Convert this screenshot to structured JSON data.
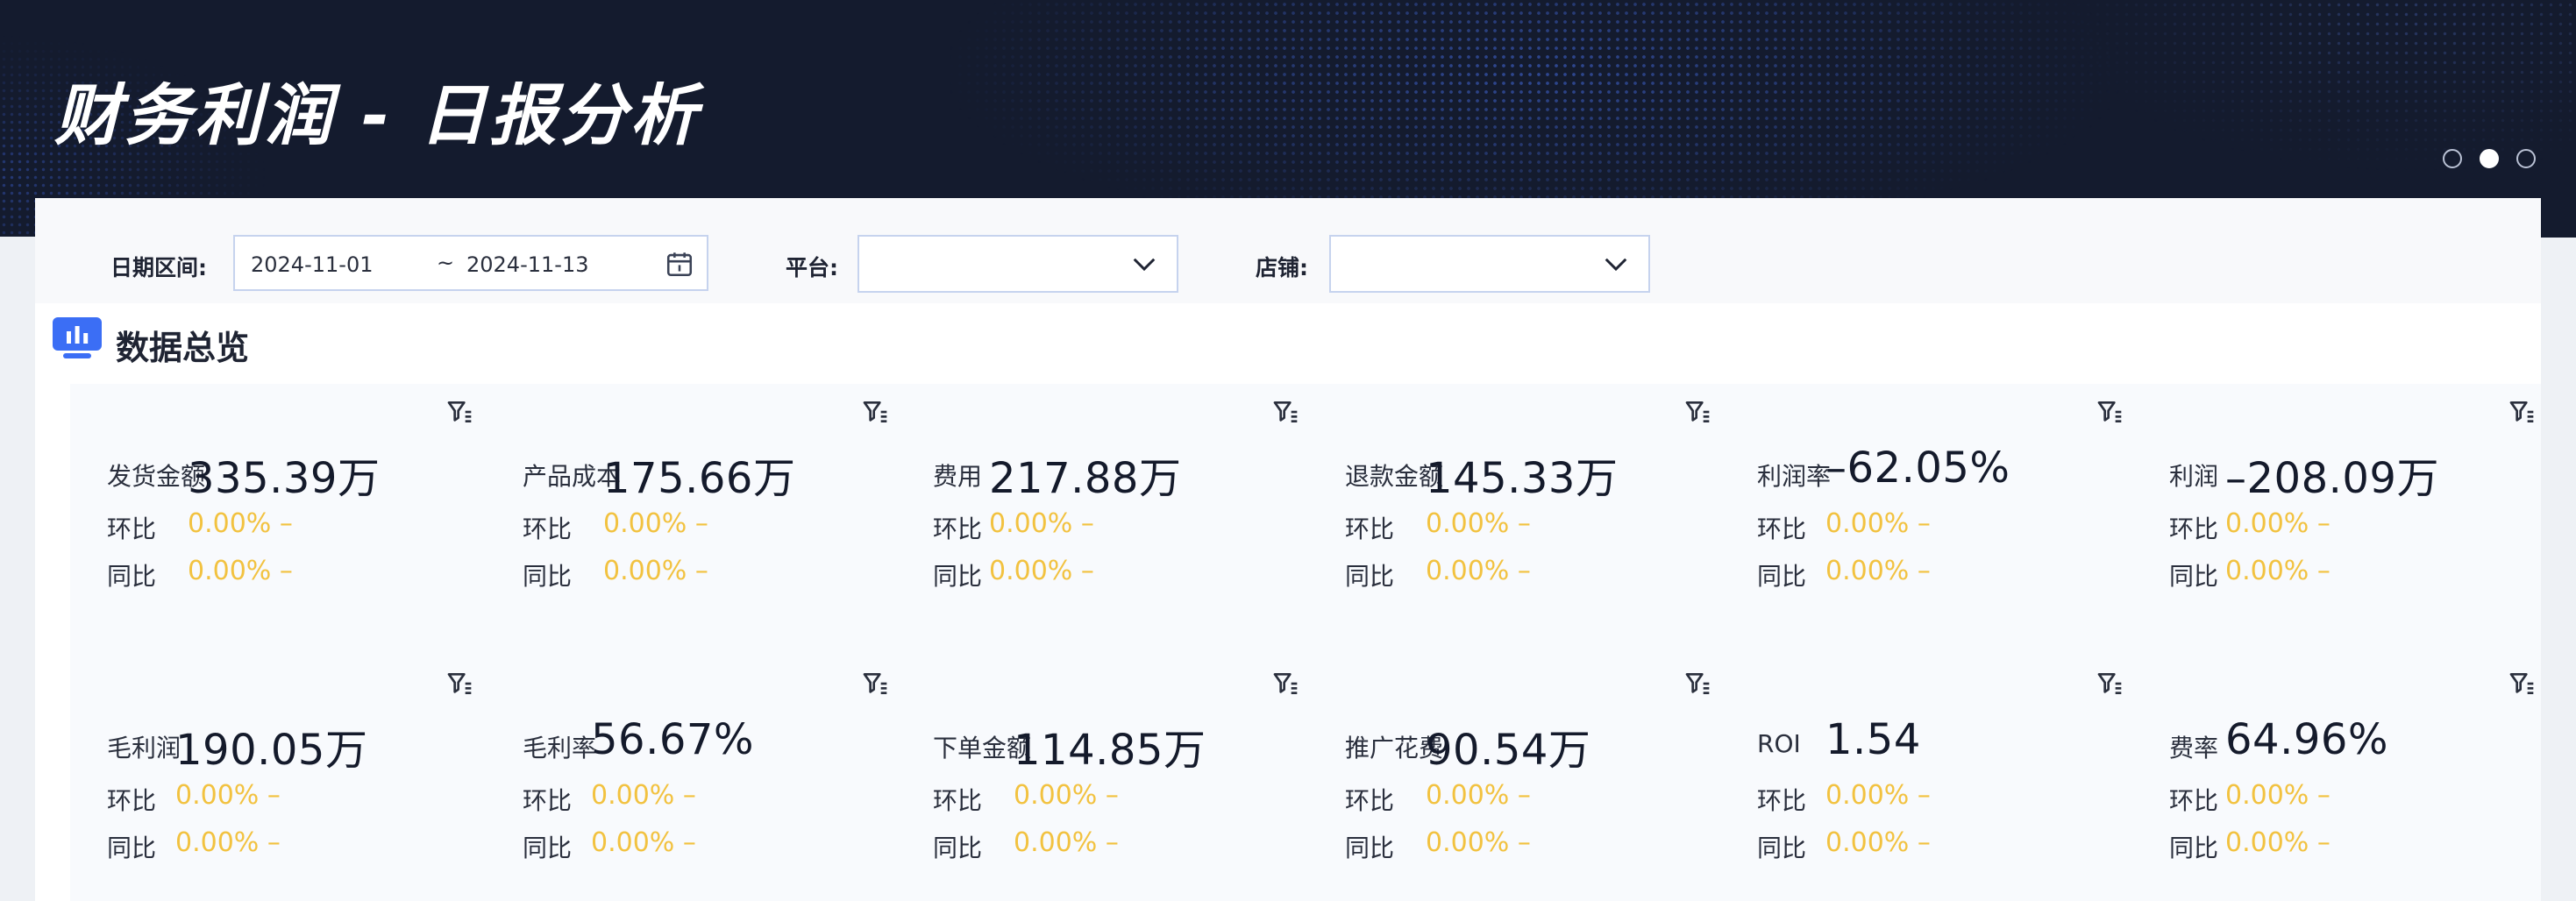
{
  "header": {
    "title": "财务利润 - 日报分析",
    "carousel": {
      "count": 3,
      "active_index": 1
    }
  },
  "filters": {
    "date_label": "日期区间:",
    "date_start": "2024-11-01",
    "date_separator": "~",
    "date_end": "2024-11-13",
    "platform_label": "平台:",
    "platform_value": "",
    "shop_label": "店铺:",
    "shop_value": ""
  },
  "section": {
    "title": "数据总览"
  },
  "metrics": [
    {
      "label": "发货金额",
      "value": "335.39万",
      "mom_label": "环比",
      "mom_value": "0.00% –",
      "yoy_label": "同比",
      "yoy_value": "0.00% –"
    },
    {
      "label": "产品成本",
      "value": "175.66万",
      "mom_label": "环比",
      "mom_value": "0.00% –",
      "yoy_label": "同比",
      "yoy_value": "0.00% –"
    },
    {
      "label": "费用",
      "value": "217.88万",
      "mom_label": "环比",
      "mom_value": "0.00% –",
      "yoy_label": "同比",
      "yoy_value": "0.00% –"
    },
    {
      "label": "退款金额",
      "value": "145.33万",
      "mom_label": "环比",
      "mom_value": "0.00% –",
      "yoy_label": "同比",
      "yoy_value": "0.00% –"
    },
    {
      "label": "利润率",
      "value": "–62.05%",
      "mom_label": "环比",
      "mom_value": "0.00% –",
      "yoy_label": "同比",
      "yoy_value": "0.00% –"
    },
    {
      "label": "利润",
      "value": "–208.09万",
      "mom_label": "环比",
      "mom_value": "0.00% –",
      "yoy_label": "同比",
      "yoy_value": "0.00% –"
    },
    {
      "label": "毛利润",
      "value": "190.05万",
      "mom_label": "环比",
      "mom_value": "0.00% –",
      "yoy_label": "同比",
      "yoy_value": "0.00% –"
    },
    {
      "label": "毛利率",
      "value": "56.67%",
      "mom_label": "环比",
      "mom_value": "0.00% –",
      "yoy_label": "同比",
      "yoy_value": "0.00% –"
    },
    {
      "label": "下单金额",
      "value": "114.85万",
      "mom_label": "环比",
      "mom_value": "0.00% –",
      "yoy_label": "同比",
      "yoy_value": "0.00% –"
    },
    {
      "label": "推广花费",
      "value": "90.54万",
      "mom_label": "环比",
      "mom_value": "0.00% –",
      "yoy_label": "同比",
      "yoy_value": "0.00% –"
    },
    {
      "label": "ROI",
      "value": "1.54",
      "mom_label": "环比",
      "mom_value": "0.00% –",
      "yoy_label": "同比",
      "yoy_value": "0.00% –"
    },
    {
      "label": "费率",
      "value": "64.96%",
      "mom_label": "环比",
      "mom_value": "0.00% –",
      "yoy_label": "同比",
      "yoy_value": "0.00% –"
    }
  ],
  "colors": {
    "banner_bg": "#141b2e",
    "accent_blue": "#3b6ef5",
    "change_yellow": "#f2c240",
    "value_text": "#141a2b"
  },
  "icons": {
    "calendar": "calendar-icon",
    "dropdown": "chevron-down-icon",
    "section": "bar-chart-icon",
    "card_filter": "filter-icon"
  }
}
